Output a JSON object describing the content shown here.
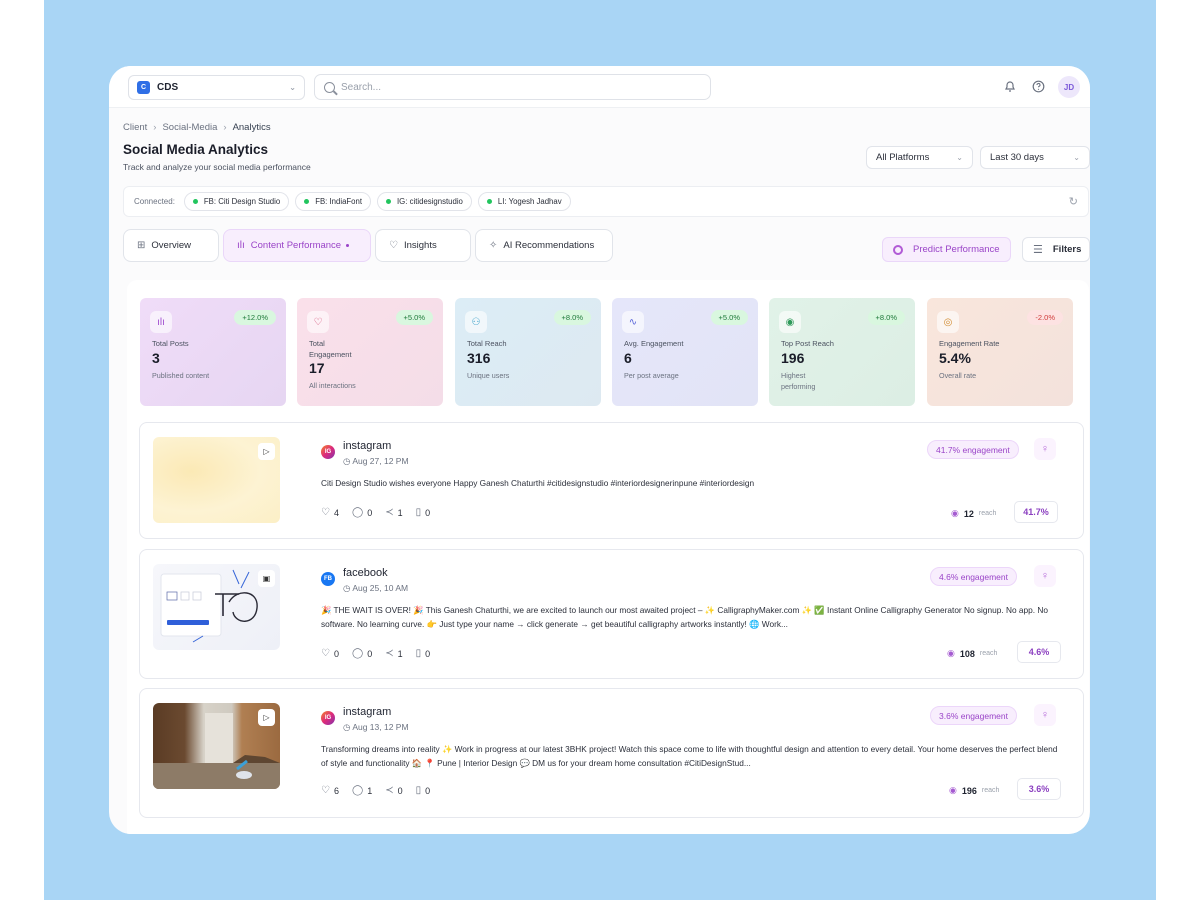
{
  "header": {
    "workspace": "CDS",
    "workspace_logo": "C",
    "search_placeholder": "Search...",
    "avatar": "JD"
  },
  "breadcrumb": [
    "Client",
    "Social-Media",
    "Analytics"
  ],
  "page": {
    "title": "Social Media Analytics",
    "subtitle": "Track and analyze your social media performance",
    "platform_filter": "All Platforms",
    "date_filter": "Last 30 days"
  },
  "connected": {
    "label": "Connected:",
    "accounts": [
      "FB: Citi Design Studio",
      "FB: IndiaFont",
      "IG: citidesignstudio",
      "LI: Yogesh Jadhav"
    ]
  },
  "tabs": [
    {
      "label": "Overview",
      "icon": "grid-icon"
    },
    {
      "label": "Content Performance",
      "icon": "bar-chart-icon",
      "active": true
    },
    {
      "label": "Insights",
      "icon": "lightbulb-icon"
    },
    {
      "label": "AI Recommendations",
      "icon": "sparkle-icon"
    }
  ],
  "actions": {
    "predict": "Predict Performance",
    "filters": "Filters"
  },
  "stats": [
    {
      "label": "Total Posts",
      "value": "3",
      "desc": "Published content",
      "change": "+12.0%",
      "color": "#ecd9f6"
    },
    {
      "label": "Total Engagement",
      "value": "17",
      "desc": "All interactions",
      "change": "+5.0%",
      "color": "#f8dde8"
    },
    {
      "label": "Total Reach",
      "value": "316",
      "desc": "Unique users",
      "change": "+8.0%",
      "color": "#dbecf5"
    },
    {
      "label": "Avg. Engagement",
      "value": "6",
      "desc": "Per post average",
      "change": "+5.0%",
      "color": "#e3e5f9"
    },
    {
      "label": "Top Post Reach",
      "value": "196",
      "desc": "Highest performing",
      "change": "+8.0%",
      "color": "#dff0e6"
    },
    {
      "label": "Engagement Rate",
      "value": "5.4%",
      "desc": "Overall rate",
      "change": "-2.0%",
      "color": "#f7e4dc"
    }
  ],
  "posts": [
    {
      "platform": "instagram",
      "platform_code": "IG",
      "date": "Aug 27, 12 PM",
      "text": "Citi Design Studio wishes everyone Happy Ganesh Chaturthi #citidesignstudio #interiordesignerinpune #interiordesign",
      "likes": "4",
      "comments": "0",
      "shares": "1",
      "saves": "0",
      "engagement": "41.7% engagement",
      "reach": "12",
      "reach_label": "reach",
      "pct": "41.7%"
    },
    {
      "platform": "facebook",
      "platform_code": "FB",
      "date": "Aug 25, 10 AM",
      "text": "🎉 THE WAIT IS OVER! 🎉 This Ganesh Chaturthi, we are excited to launch our most awaited project – ✨ CalligraphyMaker.com ✨ ✅ Instant Online Calligraphy Generator No signup. No app. No software. No learning curve. 👉 Just type your name → click generate → get beautiful calligraphy artworks instantly! 🌐 Work...",
      "likes": "0",
      "comments": "0",
      "shares": "1",
      "saves": "0",
      "engagement": "4.6% engagement",
      "reach": "108",
      "reach_label": "reach",
      "pct": "4.6%"
    },
    {
      "platform": "instagram",
      "platform_code": "IG",
      "date": "Aug 13, 12 PM",
      "text": "Transforming dreams into reality ✨ Work in progress at our latest 3BHK project! Watch this space come to life with thoughtful design and attention to every detail. Your home deserves the perfect blend of style and functionality 🏠 📍 Pune | Interior Design 💬 DM us for your dream home consultation #CitiDesignStud...",
      "likes": "6",
      "comments": "1",
      "shares": "0",
      "saves": "0",
      "engagement": "3.6% engagement",
      "reach": "196",
      "reach_label": "reach",
      "pct": "3.6%"
    }
  ],
  "thumb2": {
    "brand": "CalligraphyMaker"
  }
}
